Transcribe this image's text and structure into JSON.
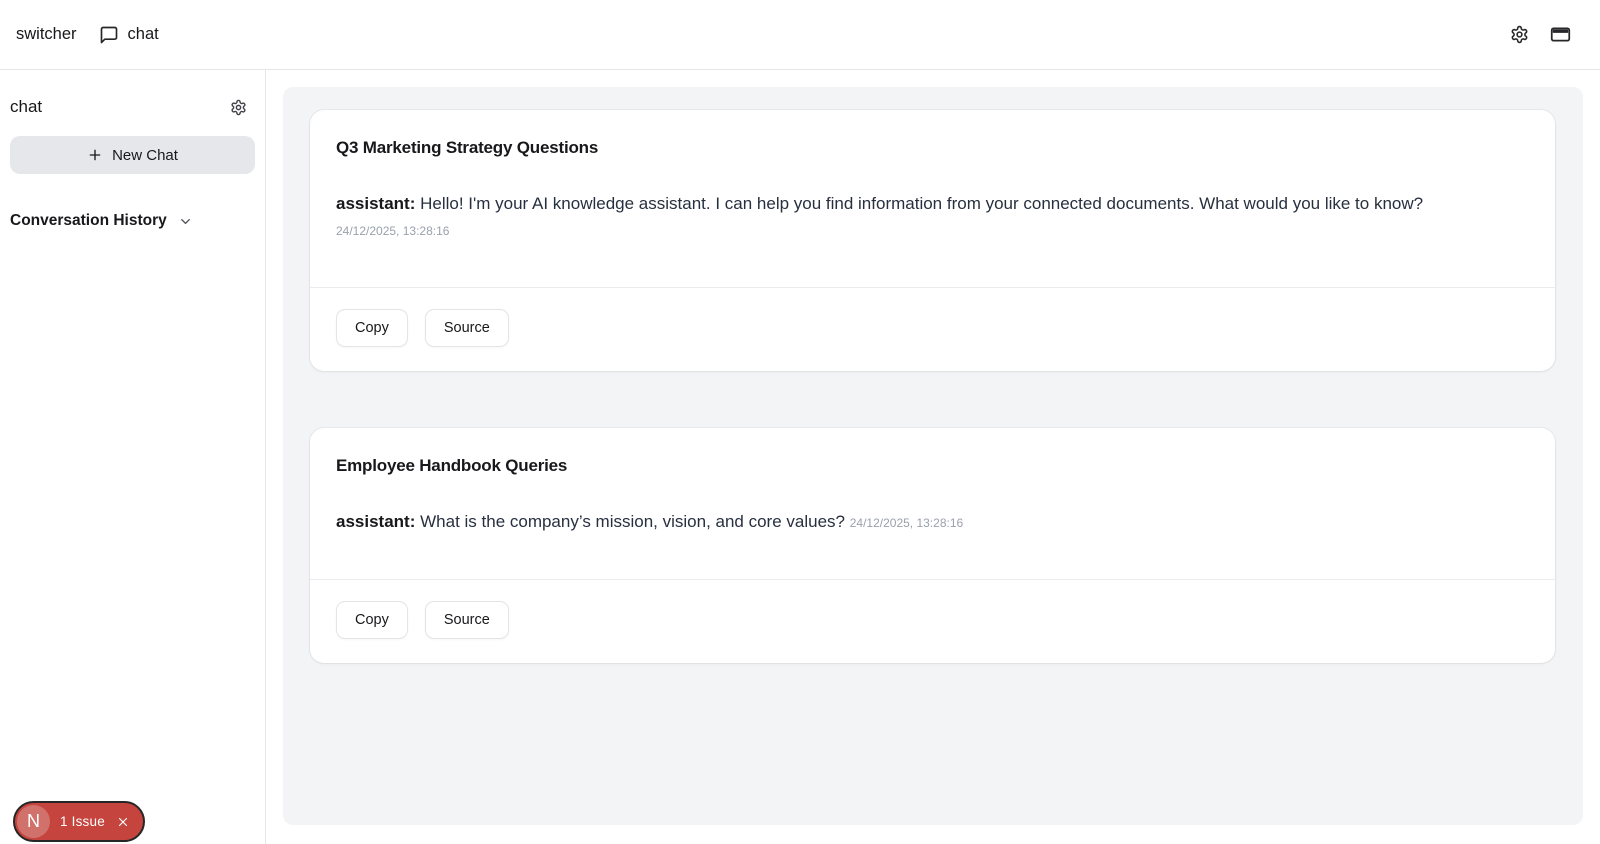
{
  "header": {
    "switcher_label": "switcher",
    "nav_label": "chat"
  },
  "sidebar": {
    "title": "chat",
    "new_chat_label": "New Chat",
    "history_label": "Conversation History"
  },
  "conversations": [
    {
      "title": "Q3 Marketing Strategy Questions",
      "message": {
        "role": "assistant:",
        "text": "Hello! I'm your AI knowledge assistant. I can help you find information from your connected documents. What would you like to know?",
        "timestamp": "24/12/2025, 13:28:16"
      },
      "actions": [
        "Copy",
        "Source"
      ]
    },
    {
      "title": "Employee Handbook Queries",
      "message": {
        "role": "assistant:",
        "text": "What is the company’s mission, vision, and core values?",
        "timestamp": "24/12/2025, 13:28:16"
      },
      "actions": [
        "Copy",
        "Source"
      ]
    }
  ],
  "issue_badge": {
    "initial": "N",
    "label": "1 Issue"
  },
  "icons": {
    "header_nav": "chat-bubble-icon",
    "header_right_1": "gear-icon",
    "header_right_2": "credit-card-icon",
    "sidebar_settings": "gear-icon",
    "new_chat": "plus-icon",
    "history_toggle": "chevron-down-icon",
    "badge_close": "close-icon"
  },
  "colors": {
    "panel_bg": "#f3f4f6",
    "card_bg": "#ffffff",
    "border": "#e6e6e9",
    "text_primary": "#18181b",
    "text_muted": "#9aa1ac",
    "badge_bg": "#c5443d",
    "badge_avatar_bg": "#d0726b",
    "badge_border": "#262626",
    "new_chat_bg": "#e5e7eb"
  }
}
